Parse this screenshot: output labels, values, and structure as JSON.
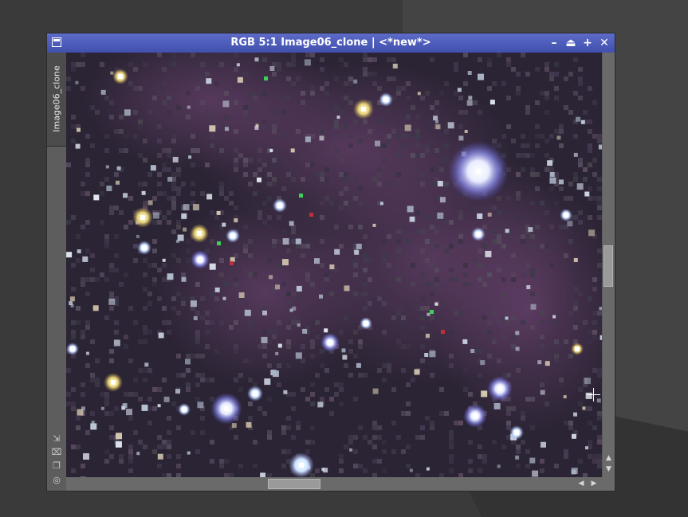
{
  "window": {
    "title": "RGB 5:1 Image06_clone | <*new*>",
    "view_id_tab": "Image06_clone",
    "titlebar_color": "#4a57b8",
    "controls": {
      "shade_glyph": "–",
      "iconize_glyph": "⏏",
      "maximize_glyph": "+",
      "close_glyph": "✕"
    }
  },
  "side_tools": [
    {
      "icon": "resize-arrow-icon",
      "glyph": "⇲"
    },
    {
      "icon": "fit-view-icon",
      "glyph": "⌧"
    },
    {
      "icon": "clone-window-icon",
      "glyph": "❐"
    },
    {
      "icon": "lock-target-icon",
      "glyph": "◎"
    }
  ],
  "scrollbars": {
    "up_glyph": "▲",
    "down_glyph": "▼",
    "left_glyph": "◀",
    "right_glyph": "▶"
  }
}
